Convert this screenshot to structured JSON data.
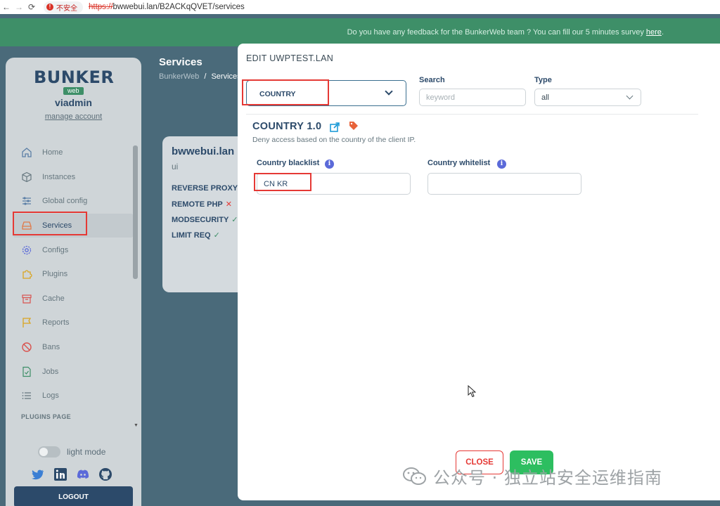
{
  "browser": {
    "security_label": "不安全",
    "url_protocol": "https://",
    "url_rest": "bwwebui.lan/B2ACKqQVET/services"
  },
  "banner": {
    "text": "Do you have any feedback for the BunkerWeb team ? You can fill our 5 minutes survey",
    "link": "here",
    "end": "."
  },
  "sidebar": {
    "logo_word": "BUNKER",
    "logo_sub": "web",
    "username": "viadmin",
    "manage_account": "manage account",
    "items": [
      {
        "label": "Home",
        "icon": "home-icon"
      },
      {
        "label": "Instances",
        "icon": "cube-icon"
      },
      {
        "label": "Global config",
        "icon": "sliders-icon"
      },
      {
        "label": "Services",
        "icon": "server-icon"
      },
      {
        "label": "Configs",
        "icon": "gear-icon"
      },
      {
        "label": "Plugins",
        "icon": "puzzle-icon"
      },
      {
        "label": "Cache",
        "icon": "archive-icon"
      },
      {
        "label": "Reports",
        "icon": "flag-icon"
      },
      {
        "label": "Bans",
        "icon": "ban-icon"
      },
      {
        "label": "Jobs",
        "icon": "file-check-icon"
      },
      {
        "label": "Logs",
        "icon": "list-icon"
      }
    ],
    "active_item": "Services",
    "plugins_page": "PLUGINS PAGE",
    "light_mode": "light mode",
    "logout": "LOGOUT"
  },
  "main": {
    "title": "Services",
    "breadcrumb_root": "BunkerWeb",
    "breadcrumb_sep": "/",
    "breadcrumb_current": "Services",
    "card": {
      "title": "bwwebui.lan",
      "subtitle": "ui",
      "rows": [
        {
          "label": "REVERSE PROXY",
          "status": ""
        },
        {
          "label": "REMOTE PHP",
          "status": "✕"
        },
        {
          "label": "MODSECURITY",
          "status": "✓"
        },
        {
          "label": "LIMIT REQ",
          "status": "✓"
        }
      ]
    }
  },
  "modal": {
    "title": "EDIT UWPTEST.LAN",
    "plugin_select": "COUNTRY",
    "search_label": "Search",
    "search_placeholder": "keyword",
    "type_label": "Type",
    "type_value": "all",
    "plugin_name": "COUNTRY 1.0",
    "plugin_desc": "Deny access based on the country of the client IP.",
    "blacklist_label": "Country blacklist",
    "blacklist_value": "CN KR",
    "whitelist_label": "Country whitelist",
    "whitelist_value": "",
    "close": "CLOSE",
    "save": "SAVE"
  },
  "watermark": {
    "text": "公众号 · 独立站安全运维指南"
  },
  "colors": {
    "brand_green": "#3e8f68",
    "brand_navy": "#2c4a6a",
    "save_green": "#2dbe60",
    "close_red": "#e53935",
    "highlight_red": "#e53935"
  }
}
